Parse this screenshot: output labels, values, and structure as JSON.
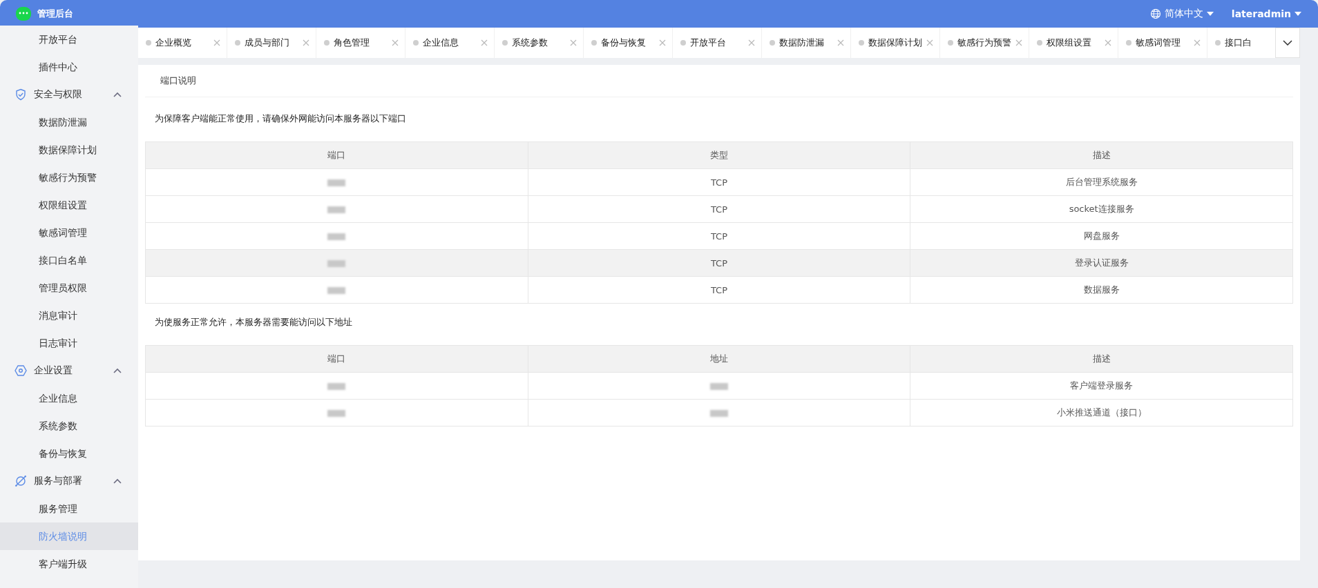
{
  "header": {
    "title": "管理后台",
    "language": "简体中文",
    "user": "lateradmin"
  },
  "sidebar": {
    "groups": [
      {
        "children": [
          {
            "label": "开放平台",
            "selected": false
          },
          {
            "label": "插件中心",
            "selected": false
          }
        ]
      },
      {
        "title": "安全与权限",
        "expanded": true,
        "children": [
          {
            "label": "数据防泄漏",
            "selected": false
          },
          {
            "label": "数据保障计划",
            "selected": false
          },
          {
            "label": "敏感行为预警",
            "selected": false
          },
          {
            "label": "权限组设置",
            "selected": false
          },
          {
            "label": "敏感词管理",
            "selected": false
          },
          {
            "label": "接口白名单",
            "selected": false
          },
          {
            "label": "管理员权限",
            "selected": false
          },
          {
            "label": "消息审计",
            "selected": false
          },
          {
            "label": "日志审计",
            "selected": false
          }
        ]
      },
      {
        "title": "企业设置",
        "expanded": true,
        "children": [
          {
            "label": "企业信息",
            "selected": false
          },
          {
            "label": "系统参数",
            "selected": false
          },
          {
            "label": "备份与恢复",
            "selected": false
          }
        ]
      },
      {
        "title": "服务与部署",
        "expanded": true,
        "children": [
          {
            "label": "服务管理",
            "selected": false
          },
          {
            "label": "防火墙说明",
            "selected": true
          },
          {
            "label": "客户端升级",
            "selected": false
          }
        ]
      }
    ]
  },
  "tabs": [
    {
      "label": "企业概览",
      "selected": false
    },
    {
      "label": "成员与部门",
      "selected": false
    },
    {
      "label": "角色管理",
      "selected": false
    },
    {
      "label": "企业信息",
      "selected": false
    },
    {
      "label": "系统参数",
      "selected": false
    },
    {
      "label": "备份与恢复",
      "selected": false
    },
    {
      "label": "开放平台",
      "selected": false
    },
    {
      "label": "数据防泄漏",
      "selected": false
    },
    {
      "label": "数据保障计划",
      "selected": false
    },
    {
      "label": "敏感行为预警",
      "selected": false
    },
    {
      "label": "权限组设置",
      "selected": false
    },
    {
      "label": "敏感词管理",
      "selected": false
    },
    {
      "label": "接口白",
      "selected": false
    }
  ],
  "panel": {
    "title": "端口说明",
    "sections": [
      {
        "heading": "为保障客户端能正常使用，请确保外网能访问本服务器以下端口",
        "columns": [
          "端口",
          "类型",
          "描述"
        ],
        "rows": [
          {
            "hovered": false,
            "cells": [
              {
                "redacted": true
              },
              {
                "text": "TCP"
              },
              {
                "text": "后台管理系统服务"
              }
            ]
          },
          {
            "hovered": false,
            "cells": [
              {
                "redacted": true
              },
              {
                "text": "TCP"
              },
              {
                "text": "socket连接服务"
              }
            ]
          },
          {
            "hovered": false,
            "cells": [
              {
                "redacted": true
              },
              {
                "text": "TCP"
              },
              {
                "text": "网盘服务"
              }
            ]
          },
          {
            "hovered": true,
            "cells": [
              {
                "redacted": true
              },
              {
                "text": "TCP"
              },
              {
                "text": "登录认证服务"
              }
            ]
          },
          {
            "hovered": false,
            "cells": [
              {
                "redacted": true
              },
              {
                "text": "TCP"
              },
              {
                "text": "数据服务"
              }
            ]
          }
        ]
      },
      {
        "heading": "为使服务正常允许，本服务器需要能访问以下地址",
        "columns": [
          "端口",
          "地址",
          "描述"
        ],
        "rows": [
          {
            "hovered": false,
            "cells": [
              {
                "redacted": true
              },
              {
                "redacted": true
              },
              {
                "text": "客户端登录服务"
              }
            ]
          },
          {
            "hovered": false,
            "cells": [
              {
                "redacted": true
              },
              {
                "redacted": true
              },
              {
                "text": "小米推送通道（接口）"
              }
            ]
          }
        ]
      }
    ]
  }
}
